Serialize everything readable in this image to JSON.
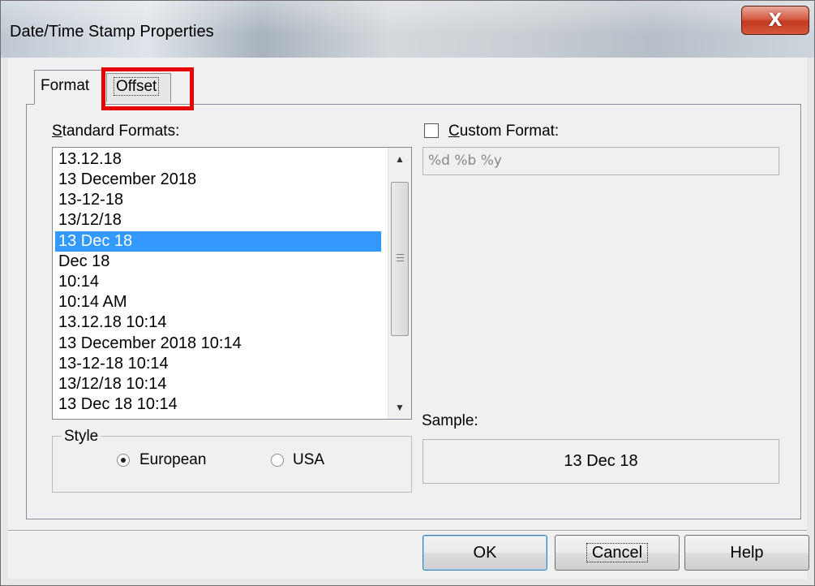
{
  "window": {
    "title": "Date/Time Stamp Properties",
    "close_glyph": "X"
  },
  "tabs": {
    "format": "Format",
    "offset": "Offset",
    "active": "Format"
  },
  "annotation": {
    "highlight_color": "#e60000",
    "target": "Offset"
  },
  "standard_formats": {
    "label_underline": "S",
    "label_rest": "tandard Formats:",
    "items": [
      "13.12.18",
      "13 December 2018",
      "13-12-18",
      "13/12/18",
      "13 Dec 18",
      "Dec 18",
      "10:14",
      "10:14 AM",
      "13.12.18 10:14",
      "13 December 2018 10:14",
      "13-12-18 10:14",
      "13/12/18 10:14",
      "13 Dec 18 10:14"
    ],
    "selected": "13 Dec 18",
    "selection_color": "#3399ff"
  },
  "style": {
    "legend": "Style",
    "options": [
      "European",
      "USA"
    ],
    "selected": "European"
  },
  "custom_format": {
    "label_underline": "C",
    "label_rest": "ustom Format:",
    "checked": false,
    "value": "%d %b %y"
  },
  "sample": {
    "label": "Sample:",
    "value": "13 Dec 18"
  },
  "buttons": {
    "ok": "OK",
    "cancel": "Cancel",
    "help": "Help"
  },
  "icons": [
    "close-icon",
    "scroll-up-icon",
    "scroll-down-icon",
    "scroll-grip-icon",
    "radio-icon",
    "checkbox-icon"
  ]
}
